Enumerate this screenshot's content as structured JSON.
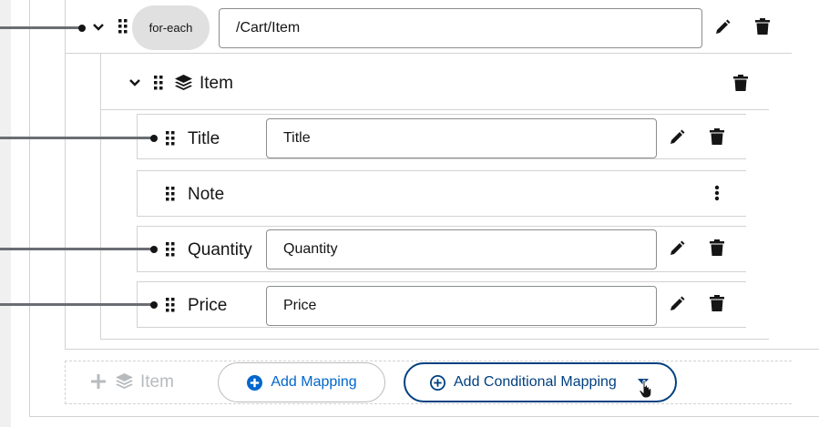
{
  "foreach": {
    "pill": "for-each",
    "expression": "/Cart/Item"
  },
  "item_group": {
    "label": "Item"
  },
  "fields": [
    {
      "label": "Title",
      "value": "Title"
    },
    {
      "label": "Note"
    },
    {
      "label": "Quantity",
      "value": "Quantity"
    },
    {
      "label": "Price",
      "value": "Price"
    }
  ],
  "footer": {
    "add_item_label": "Item",
    "add_mapping_label": "Add Mapping",
    "add_conditional_label": "Add Conditional Mapping"
  },
  "colors": {
    "accent": "#004080",
    "link": "#0066cc",
    "connector": "#6a6e73",
    "border": "#d2d2d2"
  },
  "icons": [
    "chevron-down-icon",
    "drag-handle-icon",
    "layers-icon",
    "pencil-icon",
    "trash-icon",
    "kebab-icon",
    "plus-icon",
    "plus-circle-icon",
    "caret-down-icon",
    "hand-cursor-icon"
  ]
}
